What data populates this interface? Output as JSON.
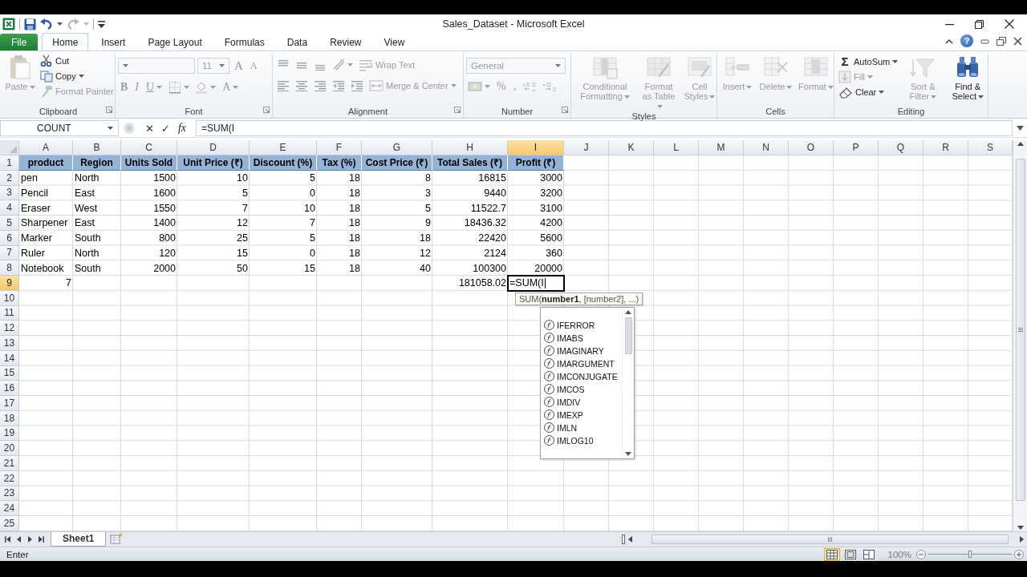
{
  "window": {
    "title": "Sales_Dataset - Microsoft Excel",
    "help": "?"
  },
  "ribbon_tabs": [
    {
      "label": "File",
      "kind": "file",
      "selected": false
    },
    {
      "label": "Home",
      "kind": "tab",
      "selected": true
    },
    {
      "label": "Insert",
      "kind": "tab",
      "selected": false
    },
    {
      "label": "Page Layout",
      "kind": "tab",
      "selected": false
    },
    {
      "label": "Formulas",
      "kind": "tab",
      "selected": false
    },
    {
      "label": "Data",
      "kind": "tab",
      "selected": false
    },
    {
      "label": "Review",
      "kind": "tab",
      "selected": false
    },
    {
      "label": "View",
      "kind": "tab",
      "selected": false
    }
  ],
  "ribbon_groups": [
    {
      "label": "Clipboard",
      "sections": [
        [
          {
            "kind": "large",
            "label": "Paste",
            "disabled": true,
            "menu": true
          }
        ],
        [
          {
            "kind": "small",
            "label": "Cut",
            "disabled": false,
            "menu": false
          },
          {
            "kind": "small",
            "label": "Copy",
            "disabled": false,
            "menu": true
          },
          {
            "kind": "small",
            "label": "Format Painter",
            "disabled": true,
            "menu": false
          }
        ]
      ]
    },
    {
      "label": "Font",
      "sections": [
        [
          {
            "kind": "field",
            "disabled": true
          },
          {
            "kind": "field",
            "value": "11",
            "disabled": true
          },
          {
            "kind": "glyph",
            "label": "A",
            "disabled": true,
            "menu": false
          },
          {
            "kind": "glyph",
            "label": "A",
            "disabled": true,
            "menu": false
          }
        ],
        [
          {
            "kind": "glyph",
            "label": "B",
            "disabled": true,
            "menu": false
          },
          {
            "kind": "glyph",
            "label": "I",
            "disabled": true,
            "menu": false
          },
          {
            "kind": "glyph",
            "label": "U",
            "disabled": true,
            "menu": true
          },
          {
            "kind": "icon",
            "disabled": true,
            "menu": true
          },
          {
            "kind": "icon",
            "disabled": true,
            "menu": true
          },
          {
            "kind": "glyph",
            "label": "A",
            "disabled": true,
            "menu": true
          }
        ]
      ]
    },
    {
      "label": "Alignment",
      "sections": [
        [
          {
            "kind": "icon",
            "disabled": true,
            "menu": false
          },
          {
            "kind": "icon",
            "disabled": true,
            "menu": false
          },
          {
            "kind": "icon",
            "disabled": true,
            "menu": false
          },
          {
            "kind": "icon",
            "disabled": true,
            "menu": true
          },
          {
            "kind": "small",
            "label": "Wrap Text",
            "disabled": true,
            "menu": false
          }
        ],
        [
          {
            "kind": "icon",
            "disabled": true,
            "menu": false
          },
          {
            "kind": "icon",
            "disabled": true,
            "menu": false
          },
          {
            "kind": "icon",
            "disabled": true,
            "menu": false
          },
          {
            "kind": "icon",
            "disabled": true,
            "menu": false
          },
          {
            "kind": "icon",
            "disabled": true,
            "menu": false
          },
          {
            "kind": "small",
            "label": "Merge & Center",
            "disabled": true,
            "menu": true
          }
        ]
      ]
    },
    {
      "label": "Number",
      "sections": [
        [
          {
            "kind": "field",
            "value": "General",
            "disabled": true
          }
        ],
        [
          {
            "kind": "icon",
            "disabled": true,
            "menu": true
          },
          {
            "kind": "glyph",
            "label": "%",
            "disabled": true,
            "menu": false
          },
          {
            "kind": "glyph",
            "label": ",",
            "disabled": true,
            "menu": false
          },
          {
            "kind": "icon",
            "disabled": true,
            "menu": false
          },
          {
            "kind": "icon",
            "disabled": true,
            "menu": false
          }
        ]
      ]
    },
    {
      "label": "Styles",
      "sections": [
        [
          {
            "kind": "large",
            "label": "Conditional Formatting",
            "disabled": true,
            "menu": true
          }
        ],
        [
          {
            "kind": "large",
            "label": "Format as Table",
            "disabled": true,
            "menu": true
          }
        ],
        [
          {
            "kind": "large",
            "label": "Cell Styles",
            "disabled": true,
            "menu": true
          }
        ]
      ]
    },
    {
      "label": "Cells",
      "sections": [
        [
          {
            "kind": "large",
            "label": "Insert",
            "disabled": true,
            "menu": true
          }
        ],
        [
          {
            "kind": "large",
            "label": "Delete",
            "disabled": true,
            "menu": true
          }
        ],
        [
          {
            "kind": "large",
            "label": "Format",
            "disabled": true,
            "menu": true
          }
        ]
      ]
    },
    {
      "label": "Editing",
      "sections": [
        [
          {
            "kind": "small",
            "label": "AutoSum",
            "symbol": "Σ",
            "disabled": false,
            "menu": true
          },
          {
            "kind": "small",
            "label": "Fill",
            "disabled": true,
            "menu": true
          },
          {
            "kind": "small",
            "label": "Clear",
            "disabled": false,
            "menu": true
          }
        ],
        [
          {
            "kind": "large",
            "label": "Sort & Filter",
            "disabled": true,
            "menu": true
          }
        ],
        [
          {
            "kind": "large",
            "label": "Find & Select",
            "disabled": false,
            "menu": true
          }
        ]
      ]
    }
  ],
  "formula_bar": {
    "name_box": "COUNT",
    "cancel": "✕",
    "enter": "✓",
    "function": "fx",
    "formula": "=SUM(I"
  },
  "sheet": {
    "columns": [
      {
        "label": "A",
        "selected": false
      },
      {
        "label": "B",
        "selected": false
      },
      {
        "label": "C",
        "selected": false
      },
      {
        "label": "D",
        "selected": false
      },
      {
        "label": "E",
        "selected": false
      },
      {
        "label": "F",
        "selected": false
      },
      {
        "label": "G",
        "selected": false
      },
      {
        "label": "H",
        "selected": false
      },
      {
        "label": "I",
        "selected": true
      },
      {
        "label": "J",
        "selected": false
      },
      {
        "label": "K",
        "selected": false
      },
      {
        "label": "L",
        "selected": false
      },
      {
        "label": "M",
        "selected": false
      },
      {
        "label": "N",
        "selected": false
      },
      {
        "label": "O",
        "selected": false
      },
      {
        "label": "P",
        "selected": false
      },
      {
        "label": "Q",
        "selected": false
      },
      {
        "label": "R",
        "selected": false
      },
      {
        "label": "S",
        "selected": false
      }
    ],
    "rows": [
      {
        "label": "1",
        "selected": false,
        "kind": "header",
        "cells": [
          "product",
          "Region",
          "Units Sold",
          "Unit Price (₹)",
          "Discount (%)",
          "Tax (%)",
          "Cost Price (₹)",
          "Total Sales (₹)",
          "Profit (₹)"
        ]
      },
      {
        "label": "2",
        "selected": false,
        "kind": "data",
        "cells": [
          "pen",
          "North",
          "1500",
          "10",
          "5",
          "18",
          "8",
          "16815",
          "3000"
        ]
      },
      {
        "label": "3",
        "selected": false,
        "kind": "data",
        "cells": [
          "Pencil",
          "East",
          "1600",
          "5",
          "0",
          "18",
          "3",
          "9440",
          "3200"
        ]
      },
      {
        "label": "4",
        "selected": false,
        "kind": "data",
        "cells": [
          "Eraser",
          "West",
          "1550",
          "7",
          "10",
          "18",
          "5",
          "11522.7",
          "3100"
        ]
      },
      {
        "label": "5",
        "selected": false,
        "kind": "data",
        "cells": [
          "Sharpener",
          "East",
          "1400",
          "12",
          "7",
          "18",
          "9",
          "18436.32",
          "4200"
        ]
      },
      {
        "label": "6",
        "selected": false,
        "kind": "data",
        "cells": [
          "Marker",
          "South",
          "800",
          "25",
          "5",
          "18",
          "18",
          "22420",
          "5600"
        ]
      },
      {
        "label": "7",
        "selected": false,
        "kind": "data",
        "cells": [
          "Ruler",
          "North",
          "120",
          "15",
          "0",
          "18",
          "12",
          "2124",
          "360"
        ]
      },
      {
        "label": "8",
        "selected": false,
        "kind": "data",
        "cells": [
          "Notebook",
          "South",
          "2000",
          "50",
          "15",
          "18",
          "40",
          "100300",
          "20000"
        ]
      },
      {
        "label": "9",
        "selected": true,
        "kind": "total",
        "cells": [
          "7",
          null,
          null,
          null,
          null,
          null,
          null,
          "181058.02",
          "=SUM(I"
        ]
      },
      {
        "label": "10",
        "selected": false
      },
      {
        "label": "11",
        "selected": false
      },
      {
        "label": "12",
        "selected": false
      },
      {
        "label": "13",
        "selected": false
      },
      {
        "label": "14",
        "selected": false
      },
      {
        "label": "15",
        "selected": false
      },
      {
        "label": "16",
        "selected": false
      },
      {
        "label": "17",
        "selected": false
      },
      {
        "label": "18",
        "selected": false
      },
      {
        "label": "19",
        "selected": false
      },
      {
        "label": "20",
        "selected": false
      },
      {
        "label": "21",
        "selected": false
      },
      {
        "label": "22",
        "selected": false
      },
      {
        "label": "23",
        "selected": false
      },
      {
        "label": "24",
        "selected": false
      },
      {
        "label": "25",
        "selected": false
      }
    ]
  },
  "autocomplete": {
    "tooltip": "SUM(**number1**, [number2], ...)",
    "items": [
      {
        "label": "IFERROR",
        "selected": false
      },
      {
        "label": "IMABS",
        "selected": false
      },
      {
        "label": "IMAGINARY",
        "selected": false
      },
      {
        "label": "IMARGUMENT",
        "selected": false
      },
      {
        "label": "IMCONJUGATE",
        "selected": false
      },
      {
        "label": "IMCOS",
        "selected": false
      },
      {
        "label": "IMDIV",
        "selected": false
      },
      {
        "label": "IMEXP",
        "selected": false
      },
      {
        "label": "IMLN",
        "selected": false
      },
      {
        "label": "IMLOG10",
        "selected": false
      }
    ]
  },
  "sheet_tabs": [
    {
      "label": "Sheet1",
      "selected": true
    }
  ],
  "status_bar": {
    "mode": "Enter",
    "views": [
      {
        "kind": "normal",
        "selected": true
      },
      {
        "kind": "page_layout",
        "selected": false
      },
      {
        "kind": "page_break",
        "selected": false
      }
    ],
    "zoom": "100%",
    "zoom_slider": {
      "level": 0.5
    }
  }
}
